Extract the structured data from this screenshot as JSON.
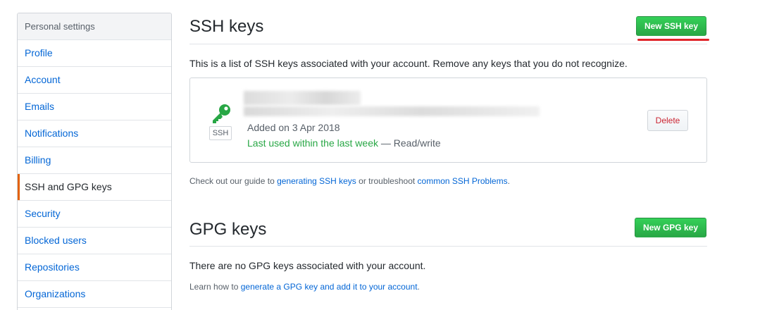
{
  "sidebar": {
    "header": "Personal settings",
    "items": [
      {
        "label": "Profile"
      },
      {
        "label": "Account"
      },
      {
        "label": "Emails"
      },
      {
        "label": "Notifications"
      },
      {
        "label": "Billing"
      },
      {
        "label": "SSH and GPG keys",
        "selected": true
      },
      {
        "label": "Security"
      },
      {
        "label": "Blocked users"
      },
      {
        "label": "Repositories"
      },
      {
        "label": "Organizations"
      }
    ]
  },
  "ssh": {
    "title": "SSH keys",
    "new_button": "New SSH key",
    "description": "This is a list of SSH keys associated with your account. Remove any keys that you do not recognize.",
    "key": {
      "type_label": "SSH",
      "icon": "key-icon",
      "added": "Added on 3 Apr 2018",
      "last_used": "Last used within the last week",
      "separator": " — ",
      "access": "Read/write",
      "delete_button": "Delete"
    },
    "guide": {
      "prefix": "Check out our guide to ",
      "link1": "generating SSH keys",
      "middle": " or troubleshoot ",
      "link2": "common SSH Problems",
      "suffix": "."
    }
  },
  "gpg": {
    "title": "GPG keys",
    "new_button": "New GPG key",
    "empty": "There are no GPG keys associated with your account.",
    "learn": {
      "prefix": "Learn how to ",
      "link": "generate a GPG key and add it to your account",
      "suffix": "."
    }
  },
  "colors": {
    "accent_selected": "#e36209",
    "link": "#0366d6",
    "primary_button": "#28a745",
    "danger": "#cb2431",
    "annotation": "#e0252a"
  }
}
